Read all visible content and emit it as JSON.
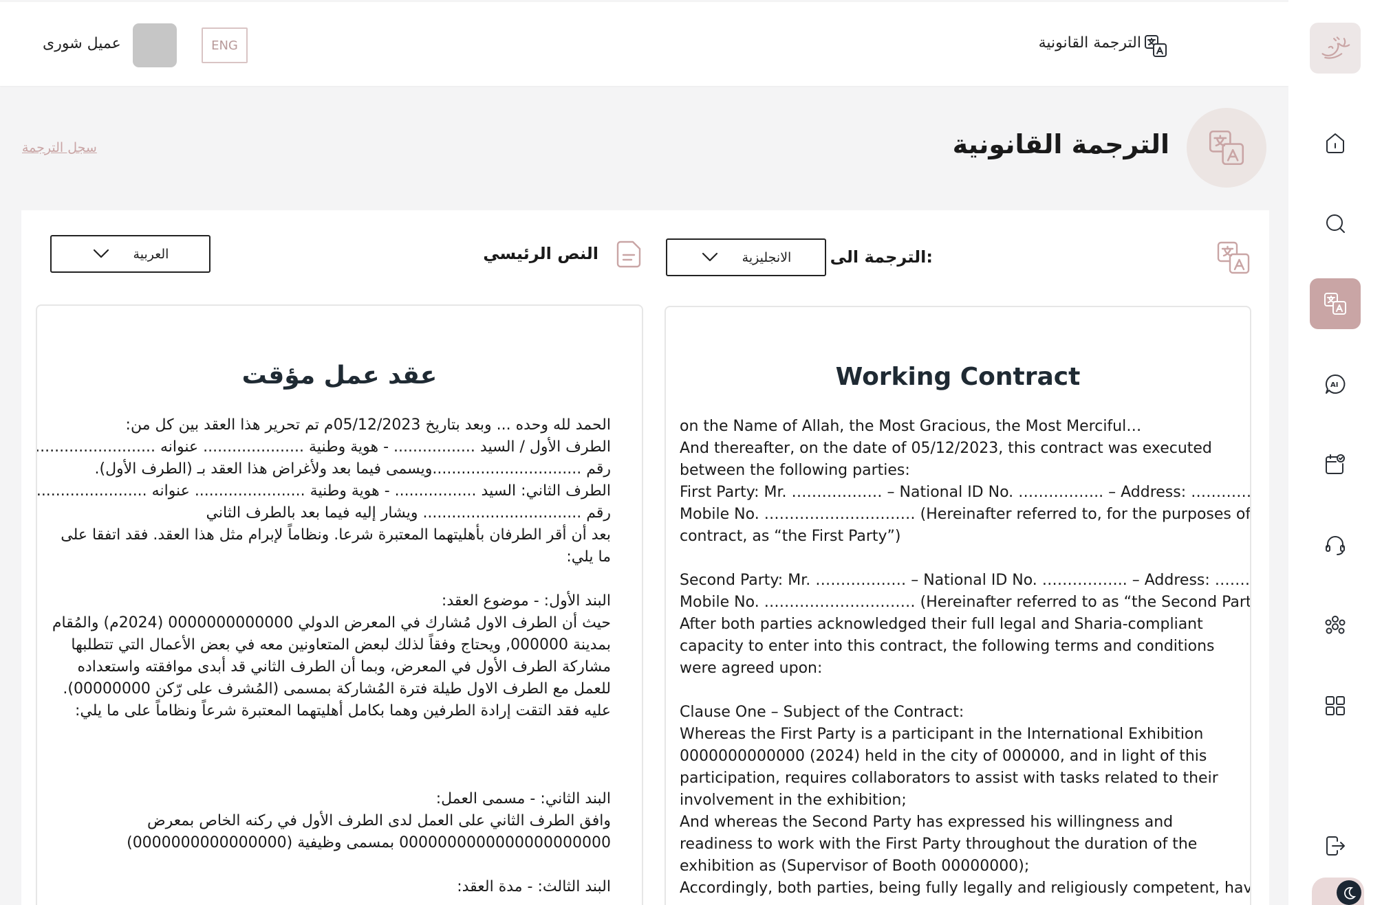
{
  "header": {
    "title": "الترجمة القانونية",
    "lang_button": "ENG",
    "user_name": "عميل شورى"
  },
  "sidebar": {
    "logo_text": "شورى",
    "items": [
      {
        "name": "home",
        "icon": "home-icon"
      },
      {
        "name": "search",
        "icon": "search-icon"
      },
      {
        "name": "translate",
        "icon": "translate-icon",
        "active": true
      },
      {
        "name": "ai-chat",
        "icon": "ai-chat-icon"
      },
      {
        "name": "verified",
        "icon": "calendar-check-icon"
      },
      {
        "name": "support",
        "icon": "headset-icon"
      },
      {
        "name": "community",
        "icon": "people-icon"
      },
      {
        "name": "apps",
        "icon": "grid-icon"
      },
      {
        "name": "logout",
        "icon": "logout-icon"
      }
    ]
  },
  "page": {
    "title": "الترجمة القانونية",
    "history_link": "سجل الترجمة"
  },
  "target": {
    "label": "الترجمة الى اللغة:",
    "selected_language": "الانجليزية",
    "heading": "Working Contract",
    "lines": [
      "on the Name of Allah, the Most Gracious, the Most Merciful…",
      "And thereafter, on the date of 05/12/2023, this contract was executed",
      "between the following parties:",
      "First Party: Mr. ……………… – National ID No. …………….. – Address: ……………………………… –",
      "Mobile No. ………………………… (Hereinafter referred to, for the purposes of this",
      "contract, as “the First Party”)",
      "",
      "Second Party: Mr. ……………… – National ID No. …………….. – Address: ……………………………… –",
      "Mobile No. ………………………… (Hereinafter referred to as “the Second Party”)",
      "After both parties acknowledged their full legal and Sharia-compliant",
      "capacity to enter into this contract, the following terms and conditions",
      "were agreed upon:",
      "",
      "Clause One – Subject of the Contract:",
      "Whereas the First Party is a participant in the International Exhibition",
      "0000000000000 (2024) held in the city of 000000, and in light of this",
      "participation, requires collaborators to assist with tasks related to their",
      "involvement in the exhibition;",
      "And whereas the Second Party has expressed his willingness and",
      "readiness to work with the First Party throughout the duration of the",
      "exhibition as (Supervisor of Booth 00000000);",
      "Accordingly, both parties, being fully legally and religiously competent, have"
    ]
  },
  "source": {
    "label": "النص الرئيسي",
    "selected_language": "العربية",
    "heading": "عقد عمل مؤقت",
    "lines": [
      "الحمد لله وحده ... وبعد بتاريخ 05/12/2023م تم تحرير هذا العقد بين كل من:",
      "الطرف الأول / السيد ................. - هوية وطنية ..................... عنوانه ...................................... جوال",
      "رقم ...............................ويسمى فيما بعد ولأغراض هذا العقد بـ (الطرف الأول).",
      "الطرف الثاني: السيد ................. - هوية وطنية ....................... عنوانه .................................... جوال",
      "رقم ................................. ويشار إليه فيما بعد بالطرف الثاني",
      "بعد أن أقر الطرفان بأهليتهما المعتبرة شرعا. ونظاماً لإبرام مثل هذا العقد. فقد اتفقا على",
      "ما يلي:",
      "",
      "البند الأول: - موضوع العقد:",
      "حيث أن الطرف الاول مُشارك في المعرض الدولي 0000000000000 (2024م) والمُقام",
      "بمدينة 000000, ويحتاج وفقاً لذلك لبعض المتعاونين معه في بعض الأعمال التي تتطلبها",
      "مشاركة الطرف الأول في المعرض، وبما أن الطرف الثاني قد أبدى موافقته واستعداده",
      "للعمل مع الطرف الاول طيلة فترة المُشاركة بمسمى (المُشرف على رّكن 00000000).",
      "عليه فقد التقت إرادة الطرفين وهما بكامل أهليتهما المعتبرة شرعاً ونظاماً على ما يلي:",
      "",
      "",
      "",
      "البند الثاني: - مسمى العمل:",
      "وافق الطرف الثاني على العمل لدى الطرف الأول في ركنه الخاص بمعرض",
      "0000000000000000000000 بمسمى وظيفية (0000000000000000)",
      "",
      "البند الثالث: - مدة العقد:"
    ]
  },
  "colors": {
    "accent": "#c9a5a5",
    "accent_light": "#ede7e7",
    "dark": "#1c2733"
  }
}
